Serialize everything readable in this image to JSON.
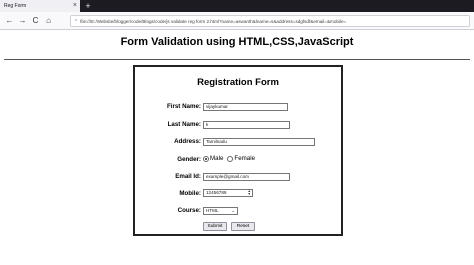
{
  "browser": {
    "tab_title": "Reg Form",
    "tab_close": "×",
    "new_tab": "+",
    "back": "←",
    "forward": "→",
    "reload": "C",
    "home": "⌂",
    "url": "file:///E:/Website/blogger/code/Blogs/code/js validate reg form 2.html?name=aswanth&lname=s&address=sdgfsdf&email=&mobile="
  },
  "page": {
    "title": "Form Validation using HTML,CSS,JavaScript"
  },
  "form": {
    "heading": "Registration Form",
    "first_name": {
      "label": "First Name:",
      "value": "vijaykumar"
    },
    "last_name": {
      "label": "Last Name:",
      "value": "k"
    },
    "address": {
      "label": "Address:",
      "value": "Tamilnadu"
    },
    "gender": {
      "label": "Gender:",
      "options": [
        "Male",
        "Female"
      ],
      "selected": "Male"
    },
    "email": {
      "label": "Email Id:",
      "value": "example@gmail.com"
    },
    "mobile": {
      "label": "Mobile:",
      "value": "12456789"
    },
    "course": {
      "label": "Course:",
      "value": "HTML"
    },
    "submit_label": "Submit",
    "reset_label": "Reset"
  }
}
